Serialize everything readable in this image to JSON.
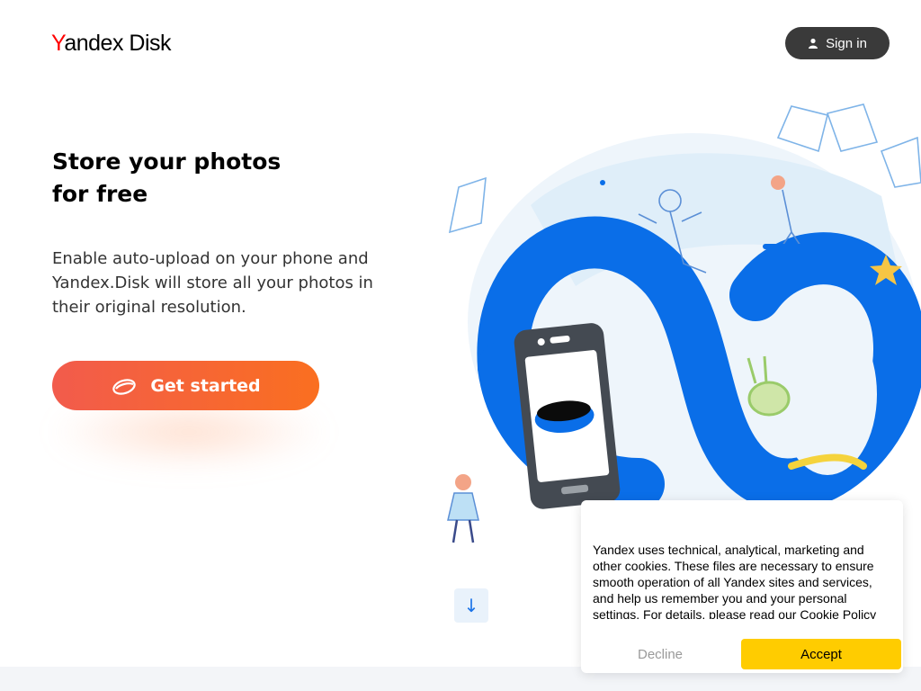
{
  "header": {
    "logo": {
      "brand_y": "Y",
      "brand_rest": "andex",
      "brand_disk": " Disk"
    },
    "sign_in_label": "Sign in",
    "sign_in_icon": "user-icon"
  },
  "hero": {
    "title_line1": "Store your photos",
    "title_line2": "for free",
    "description": "Enable auto-upload on your phone and Yandex.Disk will store all your photos in their original resolution.",
    "cta_label": "Get started",
    "cta_icon": "disk-icon"
  },
  "scroll_down_glyph": "↓",
  "cookie_banner": {
    "text": "Yandex uses technical, analytical, marketing and other cookies. These files are necessary to ensure smooth operation of all Yandex sites and services, and help us remember you and your personal settings. For details, please read our",
    "link_label": "Cookie Policy",
    "decline_label": "Decline",
    "accept_label": "Accept"
  },
  "colors": {
    "accent_blue": "#0a6ee8",
    "cta_start": "#f25b4c",
    "cta_end": "#fa6f20",
    "accept_yellow": "#ffcc00",
    "dark_button": "#3a3a3a"
  }
}
